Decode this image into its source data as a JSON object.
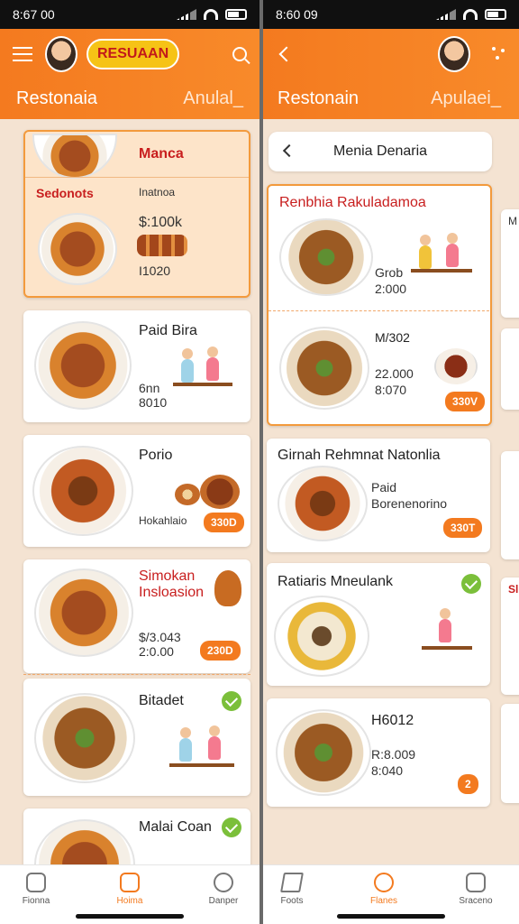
{
  "colors": {
    "accent": "#f37a1f",
    "header": "#f47a1f",
    "background": "#f4e3d2",
    "brand_red": "#c81e1e",
    "check_green": "#7bbf3a"
  },
  "left": {
    "status_time": "8:67 00",
    "logo_text": "RESUAAN",
    "header_title": "Restonaia",
    "header_sub": "Anulal_",
    "cards": [
      {
        "title": "Manca",
        "label": "Sedonots",
        "desc": "Inatnoa",
        "line1": "$:100k",
        "line2": "I1020"
      },
      {
        "title": "Paid Bira",
        "line1": "6nn",
        "line2": "8010"
      },
      {
        "title": "Porio",
        "desc": "Hokahlaio",
        "price": "330D"
      },
      {
        "title": "Simokan Insloasion",
        "line1": "$/3.043",
        "line2": "2:0.00",
        "price": "230D"
      },
      {
        "title": "Bitadet"
      },
      {
        "title": "Malai Coan"
      }
    ],
    "nav": [
      {
        "label": "Fionna",
        "icon": "home-icon"
      },
      {
        "label": "Hoima",
        "icon": "menu-icon"
      },
      {
        "label": "Danper",
        "icon": "clock-icon"
      }
    ]
  },
  "right": {
    "status_time": "8:60 09",
    "header_title": "Restonain",
    "header_sub": "Apulaei_",
    "menu_title": "Menia Denaria",
    "cards": [
      {
        "title": "Renbhia Rakuladamoa",
        "line1": "Grob",
        "line2": "2:000"
      },
      {
        "title": "M/302",
        "line1": "22.000",
        "line2": "8:070",
        "price": "330V"
      },
      {
        "title": "Girnah Rehmnat Natonlia",
        "line1": "Paid",
        "line2": "Borenenorino",
        "price": "330T"
      },
      {
        "title": "Ratiaris Mneulank"
      },
      {
        "title": "H6012",
        "line1": "R:8.009",
        "line2": "8:040",
        "price": "2"
      }
    ],
    "partial_labels": [
      "M",
      "Sl"
    ],
    "nav": [
      {
        "label": "Foots",
        "icon": "send-icon"
      },
      {
        "label": "Flanes",
        "icon": "bolt-icon"
      },
      {
        "label": "Sraceno",
        "icon": "phone-icon"
      }
    ]
  }
}
